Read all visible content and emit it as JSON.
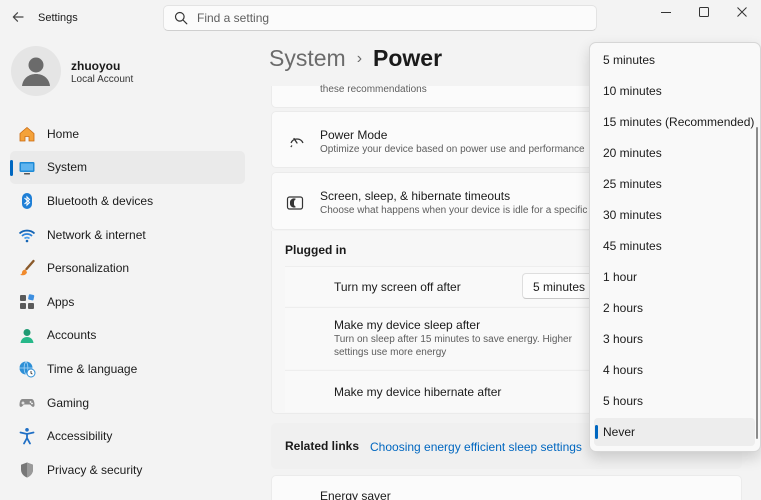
{
  "window": {
    "title": "Settings"
  },
  "search": {
    "placeholder": "Find a setting"
  },
  "user": {
    "name": "zhuoyou",
    "account_type": "Local Account"
  },
  "nav": [
    {
      "label": "Home",
      "icon": "home-icon",
      "active": false
    },
    {
      "label": "System",
      "icon": "monitor-icon",
      "active": true
    },
    {
      "label": "Bluetooth & devices",
      "icon": "bluetooth-icon",
      "active": false
    },
    {
      "label": "Network & internet",
      "icon": "wifi-icon",
      "active": false
    },
    {
      "label": "Personalization",
      "icon": "paintbrush-icon",
      "active": false
    },
    {
      "label": "Apps",
      "icon": "apps-icon",
      "active": false
    },
    {
      "label": "Accounts",
      "icon": "person-icon",
      "active": false
    },
    {
      "label": "Time & language",
      "icon": "globe-clock-icon",
      "active": false
    },
    {
      "label": "Gaming",
      "icon": "gamepad-icon",
      "active": false
    },
    {
      "label": "Accessibility",
      "icon": "accessibility-icon",
      "active": false
    },
    {
      "label": "Privacy & security",
      "icon": "shield-icon",
      "active": false
    }
  ],
  "breadcrumb": {
    "parent": "System",
    "separator": "›",
    "current": "Power"
  },
  "content": {
    "recommendation_desc": "these recommendations",
    "power_mode": {
      "title": "Power Mode",
      "desc": "Optimize your device based on power use and performance"
    },
    "timeouts": {
      "title": "Screen, sleep, & hibernate timeouts",
      "desc": "Choose what happens when your device is idle for a specific time"
    },
    "plugged_in": "Plugged in",
    "screen_off": {
      "label": "Turn my screen off after",
      "value": "5 minutes ("
    },
    "sleep": {
      "label": "Make my device sleep after",
      "desc_line1": "Turn on sleep after 15 minutes to save energy. Higher",
      "desc_line2": "settings use more energy"
    },
    "hibernate": {
      "label": "Make my device hibernate after"
    },
    "related": {
      "label": "Related links",
      "link": "Choosing energy efficient sleep settings"
    },
    "energy_saver": {
      "title": "Energy saver"
    }
  },
  "dropdown": {
    "options": [
      "5 minutes",
      "10 minutes",
      "15 minutes (Recommended)",
      "20 minutes",
      "25 minutes",
      "30 minutes",
      "45 minutes",
      "1 hour",
      "2 hours",
      "3 hours",
      "4 hours",
      "5 hours",
      "Never"
    ],
    "selected": "Never"
  },
  "colors": {
    "accent": "#0067c0",
    "background": "#f3f3f3",
    "card": "#fbfbfb"
  }
}
